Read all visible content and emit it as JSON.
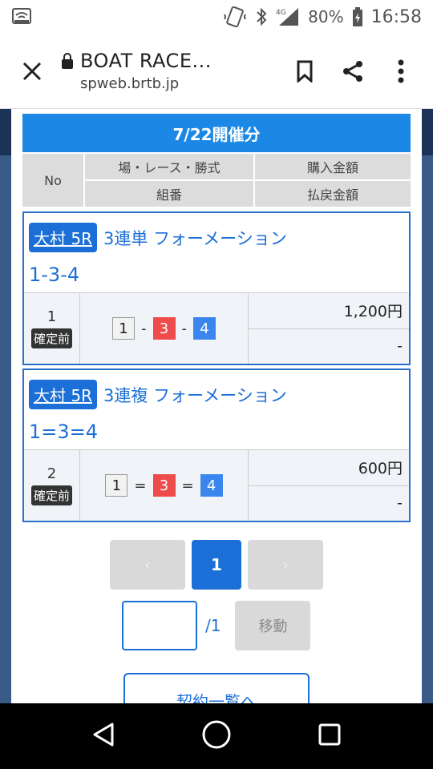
{
  "status_bar": {
    "battery": "80%",
    "time": "16:58",
    "network": "4G"
  },
  "browser": {
    "title": "BOAT RACE...",
    "url": "spweb.brtb.jp"
  },
  "page": {
    "date_header": "7/22開催分",
    "columns": {
      "no": "No",
      "venue_race_type": "場・レース・勝式",
      "purchase_amount": "購入金額",
      "combination": "組番",
      "payout_amount": "払戻金額"
    },
    "tickets": [
      {
        "venue": "大村 5R",
        "bet_type": "3連単 フォーメーション",
        "combo": "1-3-4",
        "no": "1",
        "status": "確定前",
        "balls": [
          "1",
          "3",
          "4"
        ],
        "separator": "-",
        "purchase": "1,200円",
        "payout": "-"
      },
      {
        "venue": "大村 5R",
        "bet_type": "3連複 フォーメーション",
        "combo": "1=3=4",
        "no": "2",
        "status": "確定前",
        "balls": [
          "1",
          "3",
          "4"
        ],
        "separator": "=",
        "purchase": "600円",
        "payout": "-"
      }
    ],
    "pager": {
      "prev": "‹",
      "current": "1",
      "next": "›"
    },
    "jump": {
      "total": "/1",
      "button": "移動"
    },
    "list_button": "契約一覧へ"
  },
  "colors": {
    "accent": "#1b6fd6",
    "header_blue": "#1b88e6",
    "ball_3": "#ee4b4b",
    "ball_4": "#3b86ee"
  }
}
